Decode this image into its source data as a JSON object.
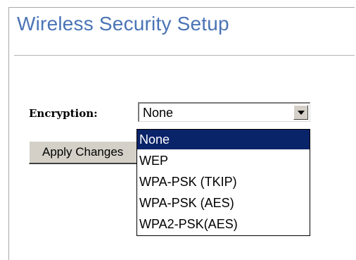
{
  "page": {
    "title": "Wireless Security Setup"
  },
  "form": {
    "encryption_label": "Encryption:",
    "selected_value": "None",
    "apply_button_label": "Apply Changes"
  },
  "dropdown": {
    "options": [
      {
        "label": "None",
        "selected": true
      },
      {
        "label": "WEP",
        "selected": false
      },
      {
        "label": "WPA-PSK (TKIP)",
        "selected": false
      },
      {
        "label": "WPA-PSK (AES)",
        "selected": false
      },
      {
        "label": "WPA2-PSK(AES)",
        "selected": false
      }
    ]
  },
  "colors": {
    "title": "#4a74b5",
    "selection_background": "#0a246a",
    "button_face": "#d4d0c8"
  },
  "icons": {
    "select_arrow": "chevron-down-icon"
  }
}
